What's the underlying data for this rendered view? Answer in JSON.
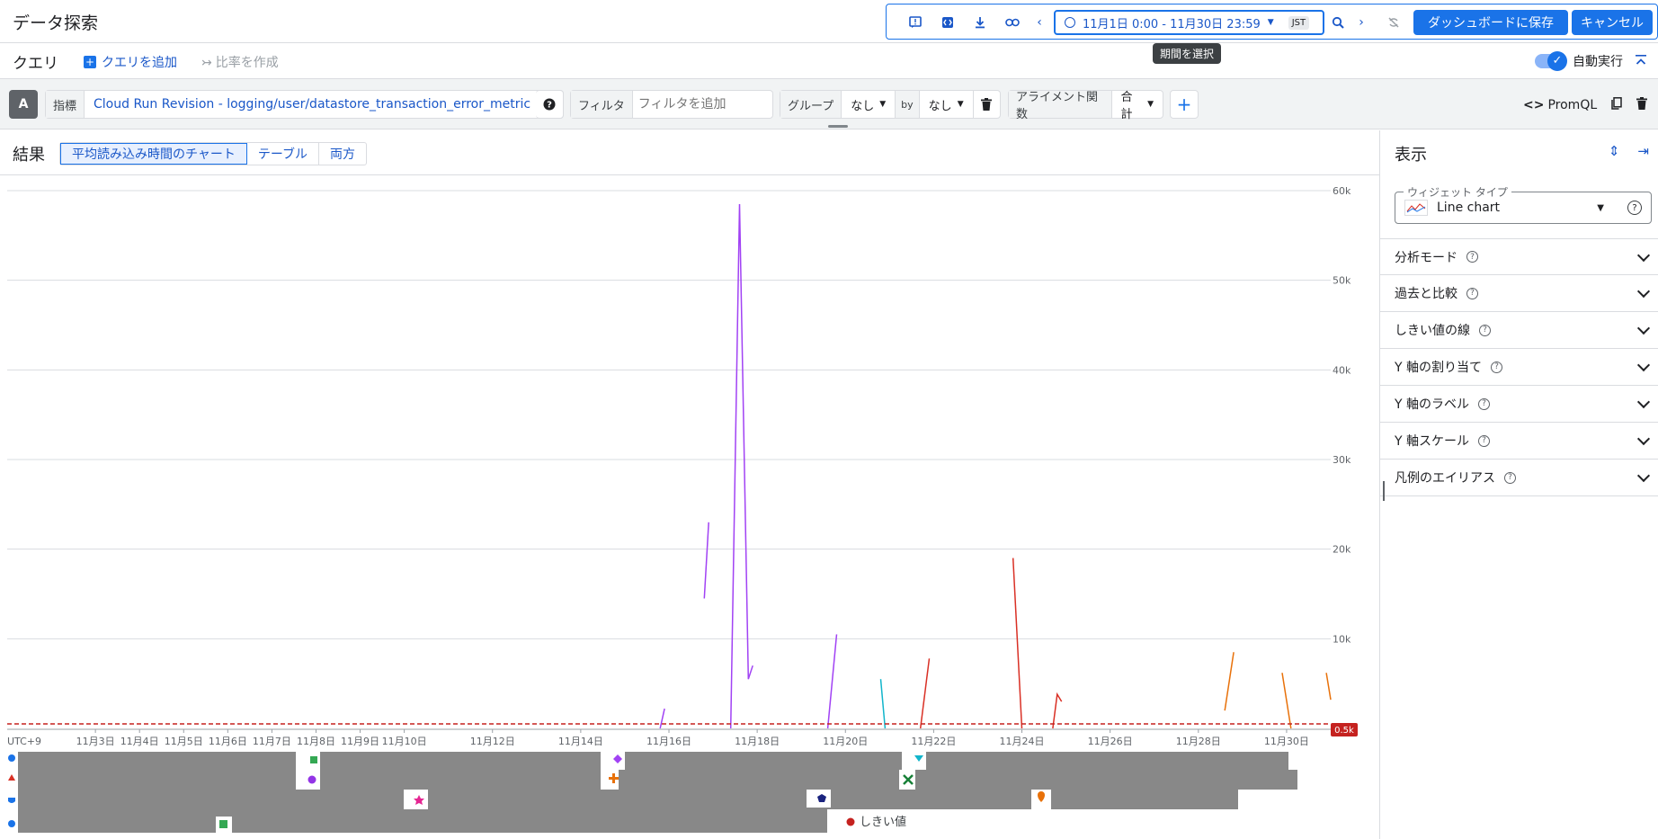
{
  "header": {
    "title": "データ探索",
    "time_range": "11月1日 0:00 - 11月30日 23:59",
    "timezone": "JST",
    "tooltip": "期間を選択",
    "save_label": "ダッシュボードに保存",
    "cancel_label": "キャンセル"
  },
  "query_bar": {
    "label": "クエリ",
    "add_query": "クエリを追加",
    "create_ratio": "比率を作成",
    "auto_run": "自動実行"
  },
  "metric_row": {
    "query_letter": "A",
    "metric_label": "指標",
    "metric_value": "Cloud Run Revision - logging/user/datastore_transaction_error_metric",
    "filter_label": "フィルタ",
    "filter_placeholder": "フィルタを追加",
    "group_label": "グループ",
    "group_value": "なし",
    "by_label": "by",
    "by_value": "なし",
    "align_label": "アライメント関数",
    "align_value": "合計",
    "promql": "PromQL"
  },
  "results": {
    "label": "結果",
    "tabs": [
      "平均読み込み時間のチャート",
      "テーブル",
      "両方"
    ],
    "active_tab": 0
  },
  "chart_data": {
    "type": "line",
    "x_labels": [
      "UTC+9",
      "11月3日",
      "11月4日",
      "11月5日",
      "11月6日",
      "11月7日",
      "11月8日",
      "11月9日",
      "11月10日",
      "11月12日",
      "11月14日",
      "11月16日",
      "11月18日",
      "11月20日",
      "11月22日",
      "11月24日",
      "11月26日",
      "11月28日",
      "11月30日"
    ],
    "y_ticks": [
      "10k",
      "20k",
      "30k",
      "40k",
      "50k",
      "60k"
    ],
    "ylim": [
      0,
      60000
    ],
    "threshold_value": 500,
    "threshold_badge": "0.5k",
    "threshold_legend": "しきい値",
    "threshold_color": "#c5221f",
    "grid": true,
    "series": [
      {
        "color": "#a142f4",
        "points": [
          [
            16.8,
            14500
          ],
          [
            16.9,
            23000
          ]
        ]
      },
      {
        "color": "#a142f4",
        "points": [
          [
            17.4,
            0
          ],
          [
            17.6,
            58500
          ],
          [
            17.8,
            5500
          ],
          [
            17.9,
            7000
          ]
        ]
      },
      {
        "color": "#a142f4",
        "points": [
          [
            19.6,
            0
          ],
          [
            19.8,
            10500
          ]
        ]
      },
      {
        "color": "#a142f4",
        "points": [
          [
            15.8,
            0
          ],
          [
            15.9,
            2200
          ]
        ]
      },
      {
        "color": "#12b5cb",
        "points": [
          [
            20.8,
            5500
          ],
          [
            20.9,
            0
          ]
        ]
      },
      {
        "color": "#d93025",
        "points": [
          [
            21.7,
            0
          ],
          [
            21.9,
            7800
          ]
        ]
      },
      {
        "color": "#d93025",
        "points": [
          [
            23.8,
            19000
          ],
          [
            24.0,
            0
          ]
        ]
      },
      {
        "color": "#d93025",
        "points": [
          [
            24.7,
            0
          ],
          [
            24.8,
            3800
          ],
          [
            24.9,
            3000
          ]
        ]
      },
      {
        "color": "#e8710a",
        "points": [
          [
            28.6,
            2000
          ],
          [
            28.8,
            8500
          ]
        ]
      },
      {
        "color": "#e8710a",
        "points": [
          [
            29.9,
            6200
          ],
          [
            30.1,
            0
          ]
        ]
      },
      {
        "color": "#e8710a",
        "points": [
          [
            30.9,
            6200
          ],
          [
            31.0,
            3200
          ]
        ]
      }
    ]
  },
  "right_panel": {
    "title": "表示",
    "widget_type_label": "ウィジェット タイプ",
    "widget_type_value": "Line chart",
    "sections": [
      "分析モード",
      "過去と比較",
      "しきい値の線",
      "Y 軸の割り当て",
      "Y 軸のラベル",
      "Y 軸スケール",
      "凡例のエイリアス"
    ]
  },
  "colors": {
    "accent": "#1a73e8",
    "legend_gray": "#888888"
  }
}
